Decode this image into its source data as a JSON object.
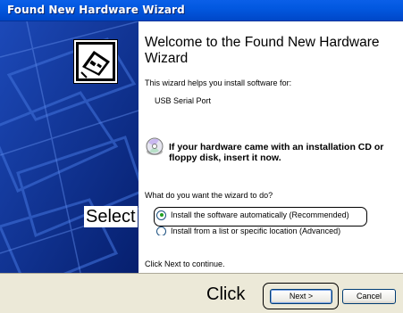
{
  "window": {
    "title": "Found New Hardware Wizard"
  },
  "content": {
    "heading": "Welcome to the Found New Hardware Wizard",
    "intro": "This wizard helps you install software for:",
    "device_name": "USB Serial Port",
    "cd_prompt": "If your hardware came with an installation CD or floppy disk, insert it now.",
    "question": "What do you want the wizard to do?",
    "options": [
      {
        "label": "Install the software automatically (Recommended)",
        "selected": true
      },
      {
        "label": "Install from a list or specific location (Advanced)",
        "selected": false
      }
    ],
    "next_hint": "Click Next to continue."
  },
  "buttons": {
    "next": "Next >",
    "cancel": "Cancel"
  },
  "annotations": {
    "select": "Select",
    "click": "Click"
  },
  "colors": {
    "titlebar": "#0258E0",
    "side_panel": "#0b2e8c",
    "dialog_face": "#ECE9D8",
    "radio_dot": "#21a121"
  },
  "icons": {
    "wizard": "hardware-card-icon",
    "cd": "cd-disc-icon"
  }
}
